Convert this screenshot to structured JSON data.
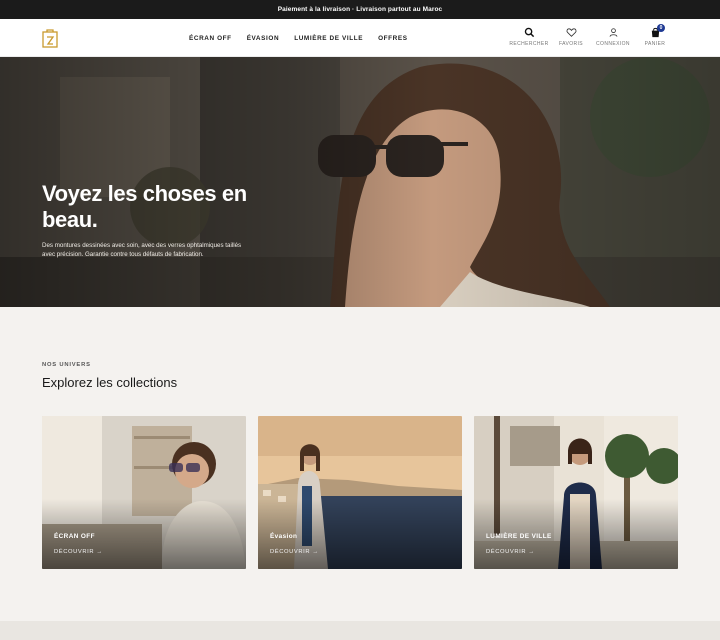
{
  "topbar": {
    "text": "Paiement à la livraison · Livraison partout au Maroc"
  },
  "header": {
    "nav": [
      "ÉCRAN OFF",
      "ÉVASION",
      "LUMIÈRE DE VILLE",
      "OFFRES"
    ],
    "actions": {
      "search": "RECHERCHER",
      "favorites": "FAVORIS",
      "login": "CONNEXION",
      "cart": "PANIER",
      "cart_count": "0"
    }
  },
  "hero": {
    "title": "Voyez les choses en beau.",
    "subtitle": "Des montures dessinées avec soin, avec des verres ophtalmiques taillés avec précision. Garantie contre tous défauts de fabrication."
  },
  "collections": {
    "eyebrow": "NOS UNIVERS",
    "heading": "Explorez les collections",
    "cards": [
      {
        "title": "ÉCRAN OFF",
        "link": "DÉCOUVRIR →"
      },
      {
        "title": "Évasion",
        "link": "DÉCOUVRIR →"
      },
      {
        "title": "LUMIÈRE DE VILLE",
        "link": "DÉCOUVRIR →"
      }
    ]
  },
  "colors": {
    "accent": "#1f3a93",
    "logo": "#c99a2e",
    "topbar": "#1b1b1b"
  }
}
